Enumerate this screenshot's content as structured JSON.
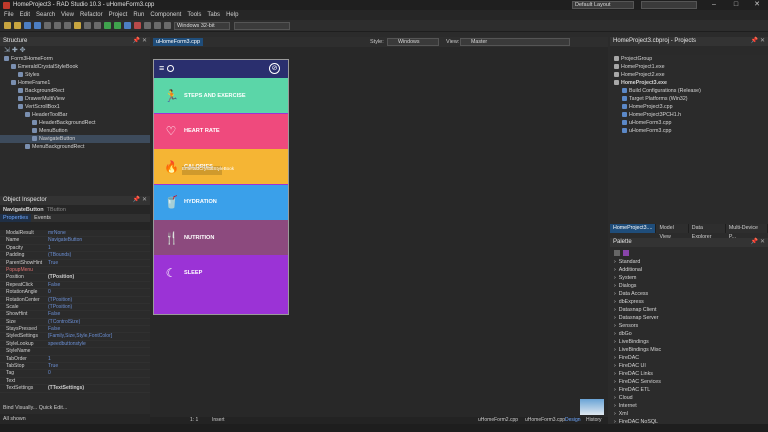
{
  "window": {
    "title": "HomeProject3 - RAD Studio 10.3 - uHomeForm3.cpp",
    "layout": "Default Layout",
    "min": "–",
    "max": "□",
    "close": "✕"
  },
  "menu": [
    "File",
    "Edit",
    "Search",
    "View",
    "Refactor",
    "Project",
    "Run",
    "Component",
    "Tools",
    "Tabs",
    "Help"
  ],
  "toolbar": {
    "platform": "Windows 32-bit",
    "config": ""
  },
  "structure": {
    "title": "Structure",
    "items": [
      {
        "label": "Form3HomeForm",
        "indent": 0
      },
      {
        "label": "EmeraldCrystalStyleBook",
        "indent": 1
      },
      {
        "label": "Styles",
        "indent": 2
      },
      {
        "label": "HomeFrame1",
        "indent": 1
      },
      {
        "label": "BackgroundRect",
        "indent": 2
      },
      {
        "label": "DrawerMultiView",
        "indent": 2
      },
      {
        "label": "VertScrollBox1",
        "indent": 2
      },
      {
        "label": "HeaderToolBar",
        "indent": 3
      },
      {
        "label": "HeaderBackgroundRect",
        "indent": 4
      },
      {
        "label": "MenuButton",
        "indent": 4
      },
      {
        "label": "NavigateButton",
        "indent": 4,
        "selected": true
      },
      {
        "label": "MenuBackgroundRect",
        "indent": 3
      }
    ]
  },
  "inspector": {
    "title": "Object Inspector",
    "object": "NavigateButton",
    "object_type": "TButton",
    "tabs": [
      "Properties",
      "Events"
    ],
    "rows": [
      {
        "k": "ModalResult",
        "v": "mrNone"
      },
      {
        "k": "Name",
        "v": "NavigateButton"
      },
      {
        "k": "Opacity",
        "v": "1"
      },
      {
        "k": "Padding",
        "v": "(TBounds)"
      },
      {
        "k": "ParentShowHint",
        "v": "True"
      },
      {
        "k": "PopupMenu",
        "v": "",
        "hl": true
      },
      {
        "k": "Position",
        "v": "(TPosition)",
        "bold": true
      },
      {
        "k": "RepeatClick",
        "v": "False"
      },
      {
        "k": "RotationAngle",
        "v": "0"
      },
      {
        "k": "RotationCenter",
        "v": "(TPosition)"
      },
      {
        "k": "Scale",
        "v": "(TPosition)"
      },
      {
        "k": "ShowHint",
        "v": "False"
      },
      {
        "k": "Size",
        "v": "(TControlSize)"
      },
      {
        "k": "StaysPressed",
        "v": "False"
      },
      {
        "k": "StyledSettings",
        "v": "[Family,Size,Style,FontColor]"
      },
      {
        "k": "StyleLookup",
        "v": "speedbuttonstyle"
      },
      {
        "k": "StyleName",
        "v": ""
      },
      {
        "k": "TabOrder",
        "v": "1"
      },
      {
        "k": "TabStop",
        "v": "True"
      },
      {
        "k": "Tag",
        "v": "0"
      },
      {
        "k": "Text",
        "v": ""
      },
      {
        "k": "TextSettings",
        "v": "(TTextSettings)",
        "bold": true
      }
    ],
    "footer": "Bind Visually...  Quick Edit...",
    "status": "All shown"
  },
  "editor": {
    "tab": "uHomeForm3.cpp",
    "style_label": "Style:",
    "style_value": "Windows",
    "view_label": "View:",
    "view_value": "Master",
    "bottom_tabs": [
      "uHomeForm2.cpp",
      "uHomeForm3.cpp",
      "Design",
      "History"
    ],
    "pos": "1: 1",
    "mode": "Insert"
  },
  "form": {
    "bands": [
      {
        "label": "STEPS AND EXERCISE",
        "color": "#5bd6a8",
        "icon": "🏃"
      },
      {
        "label": "HEART RATE",
        "color": "#ef4a7d",
        "icon": "♡"
      },
      {
        "label": "CALORIES",
        "color": "#f5b534",
        "icon": "🔥"
      },
      {
        "label": "HYDRATION",
        "color": "#3aa0ea",
        "icon": "🥤"
      },
      {
        "label": "NUTRITION",
        "color": "#8c4a7e",
        "icon": "🍴"
      },
      {
        "label": "SLEEP",
        "color": "#9b33d6",
        "icon": "☾"
      }
    ],
    "stylebook_caption": "EmeraldCrystalStyleBook"
  },
  "projects": {
    "title": "HomeProject3.cbproj - Projects",
    "items": [
      {
        "label": "ProjectGroup",
        "indent": 0
      },
      {
        "label": "HomeProject1.exe",
        "indent": 0
      },
      {
        "label": "HomeProject2.exe",
        "indent": 0
      },
      {
        "label": "HomeProject3.exe",
        "indent": 0,
        "bold": true
      },
      {
        "label": "Build Configurations (Release)",
        "indent": 1
      },
      {
        "label": "Target Platforms (Win32)",
        "indent": 1
      },
      {
        "label": "HomeProject3.cpp",
        "indent": 1
      },
      {
        "label": "HomeProject3PCH1.h",
        "indent": 1
      },
      {
        "label": "uHomeForm3.cpp",
        "indent": 1
      },
      {
        "label": "uHomeForm3.cpp",
        "indent": 1
      }
    ],
    "tabs": [
      "HomeProject3....",
      "Model View",
      "Data Explorer",
      "Multi-Device P..."
    ]
  },
  "palette": {
    "title": "Palette",
    "items": [
      "Standard",
      "Additional",
      "System",
      "Dialogs",
      "Data Access",
      "dbExpress",
      "Datasnap Client",
      "Datasnap Server",
      "Sensors",
      "dbGo",
      "LiveBindings",
      "LiveBindings Misc",
      "FireDAC",
      "FireDAC UI",
      "FireDAC Links",
      "FireDAC Services",
      "FireDAC ETL",
      "Cloud",
      "Internet",
      "Xml",
      "FireDAC NoSQL"
    ]
  }
}
